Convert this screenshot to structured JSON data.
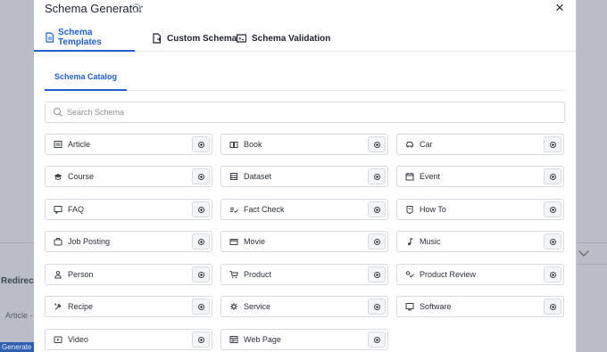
{
  "background": {
    "redirects_label": "Redirects",
    "article_label": "Article -",
    "generate_label": "Generate Sc"
  },
  "modal": {
    "title": "Schema Generator",
    "help_icon": "?",
    "close_icon": "×",
    "tabs": [
      {
        "label": "Schema Templates",
        "icon": "document-icon",
        "active": true
      },
      {
        "label": "Custom Schema",
        "icon": "custom-schema-icon",
        "active": false
      },
      {
        "label": "Schema Validation",
        "icon": "terminal-icon",
        "active": false
      }
    ],
    "subtab": {
      "label": "Schema Catalog"
    },
    "search": {
      "placeholder": "Search Schema",
      "value": ""
    },
    "schemas": [
      {
        "label": "Article",
        "icon": "article-icon"
      },
      {
        "label": "Book",
        "icon": "book-icon"
      },
      {
        "label": "Car",
        "icon": "car-icon"
      },
      {
        "label": "Course",
        "icon": "course-icon"
      },
      {
        "label": "Dataset",
        "icon": "dataset-icon"
      },
      {
        "label": "Event",
        "icon": "event-icon"
      },
      {
        "label": "FAQ",
        "icon": "faq-icon"
      },
      {
        "label": "Fact Check",
        "icon": "fact-check-icon"
      },
      {
        "label": "How To",
        "icon": "how-to-icon"
      },
      {
        "label": "Job Posting",
        "icon": "job-posting-icon"
      },
      {
        "label": "Movie",
        "icon": "movie-icon"
      },
      {
        "label": "Music",
        "icon": "music-icon"
      },
      {
        "label": "Person",
        "icon": "person-icon"
      },
      {
        "label": "Product",
        "icon": "product-icon"
      },
      {
        "label": "Product Review",
        "icon": "product-review-icon"
      },
      {
        "label": "Recipe",
        "icon": "recipe-icon"
      },
      {
        "label": "Service",
        "icon": "service-icon"
      },
      {
        "label": "Software",
        "icon": "software-icon"
      },
      {
        "label": "Video",
        "icon": "video-icon"
      },
      {
        "label": "Web Page",
        "icon": "web-page-icon"
      }
    ]
  },
  "colors": {
    "accent": "#1f5fcf",
    "text": "#1e2330",
    "border": "#d6dae1"
  }
}
